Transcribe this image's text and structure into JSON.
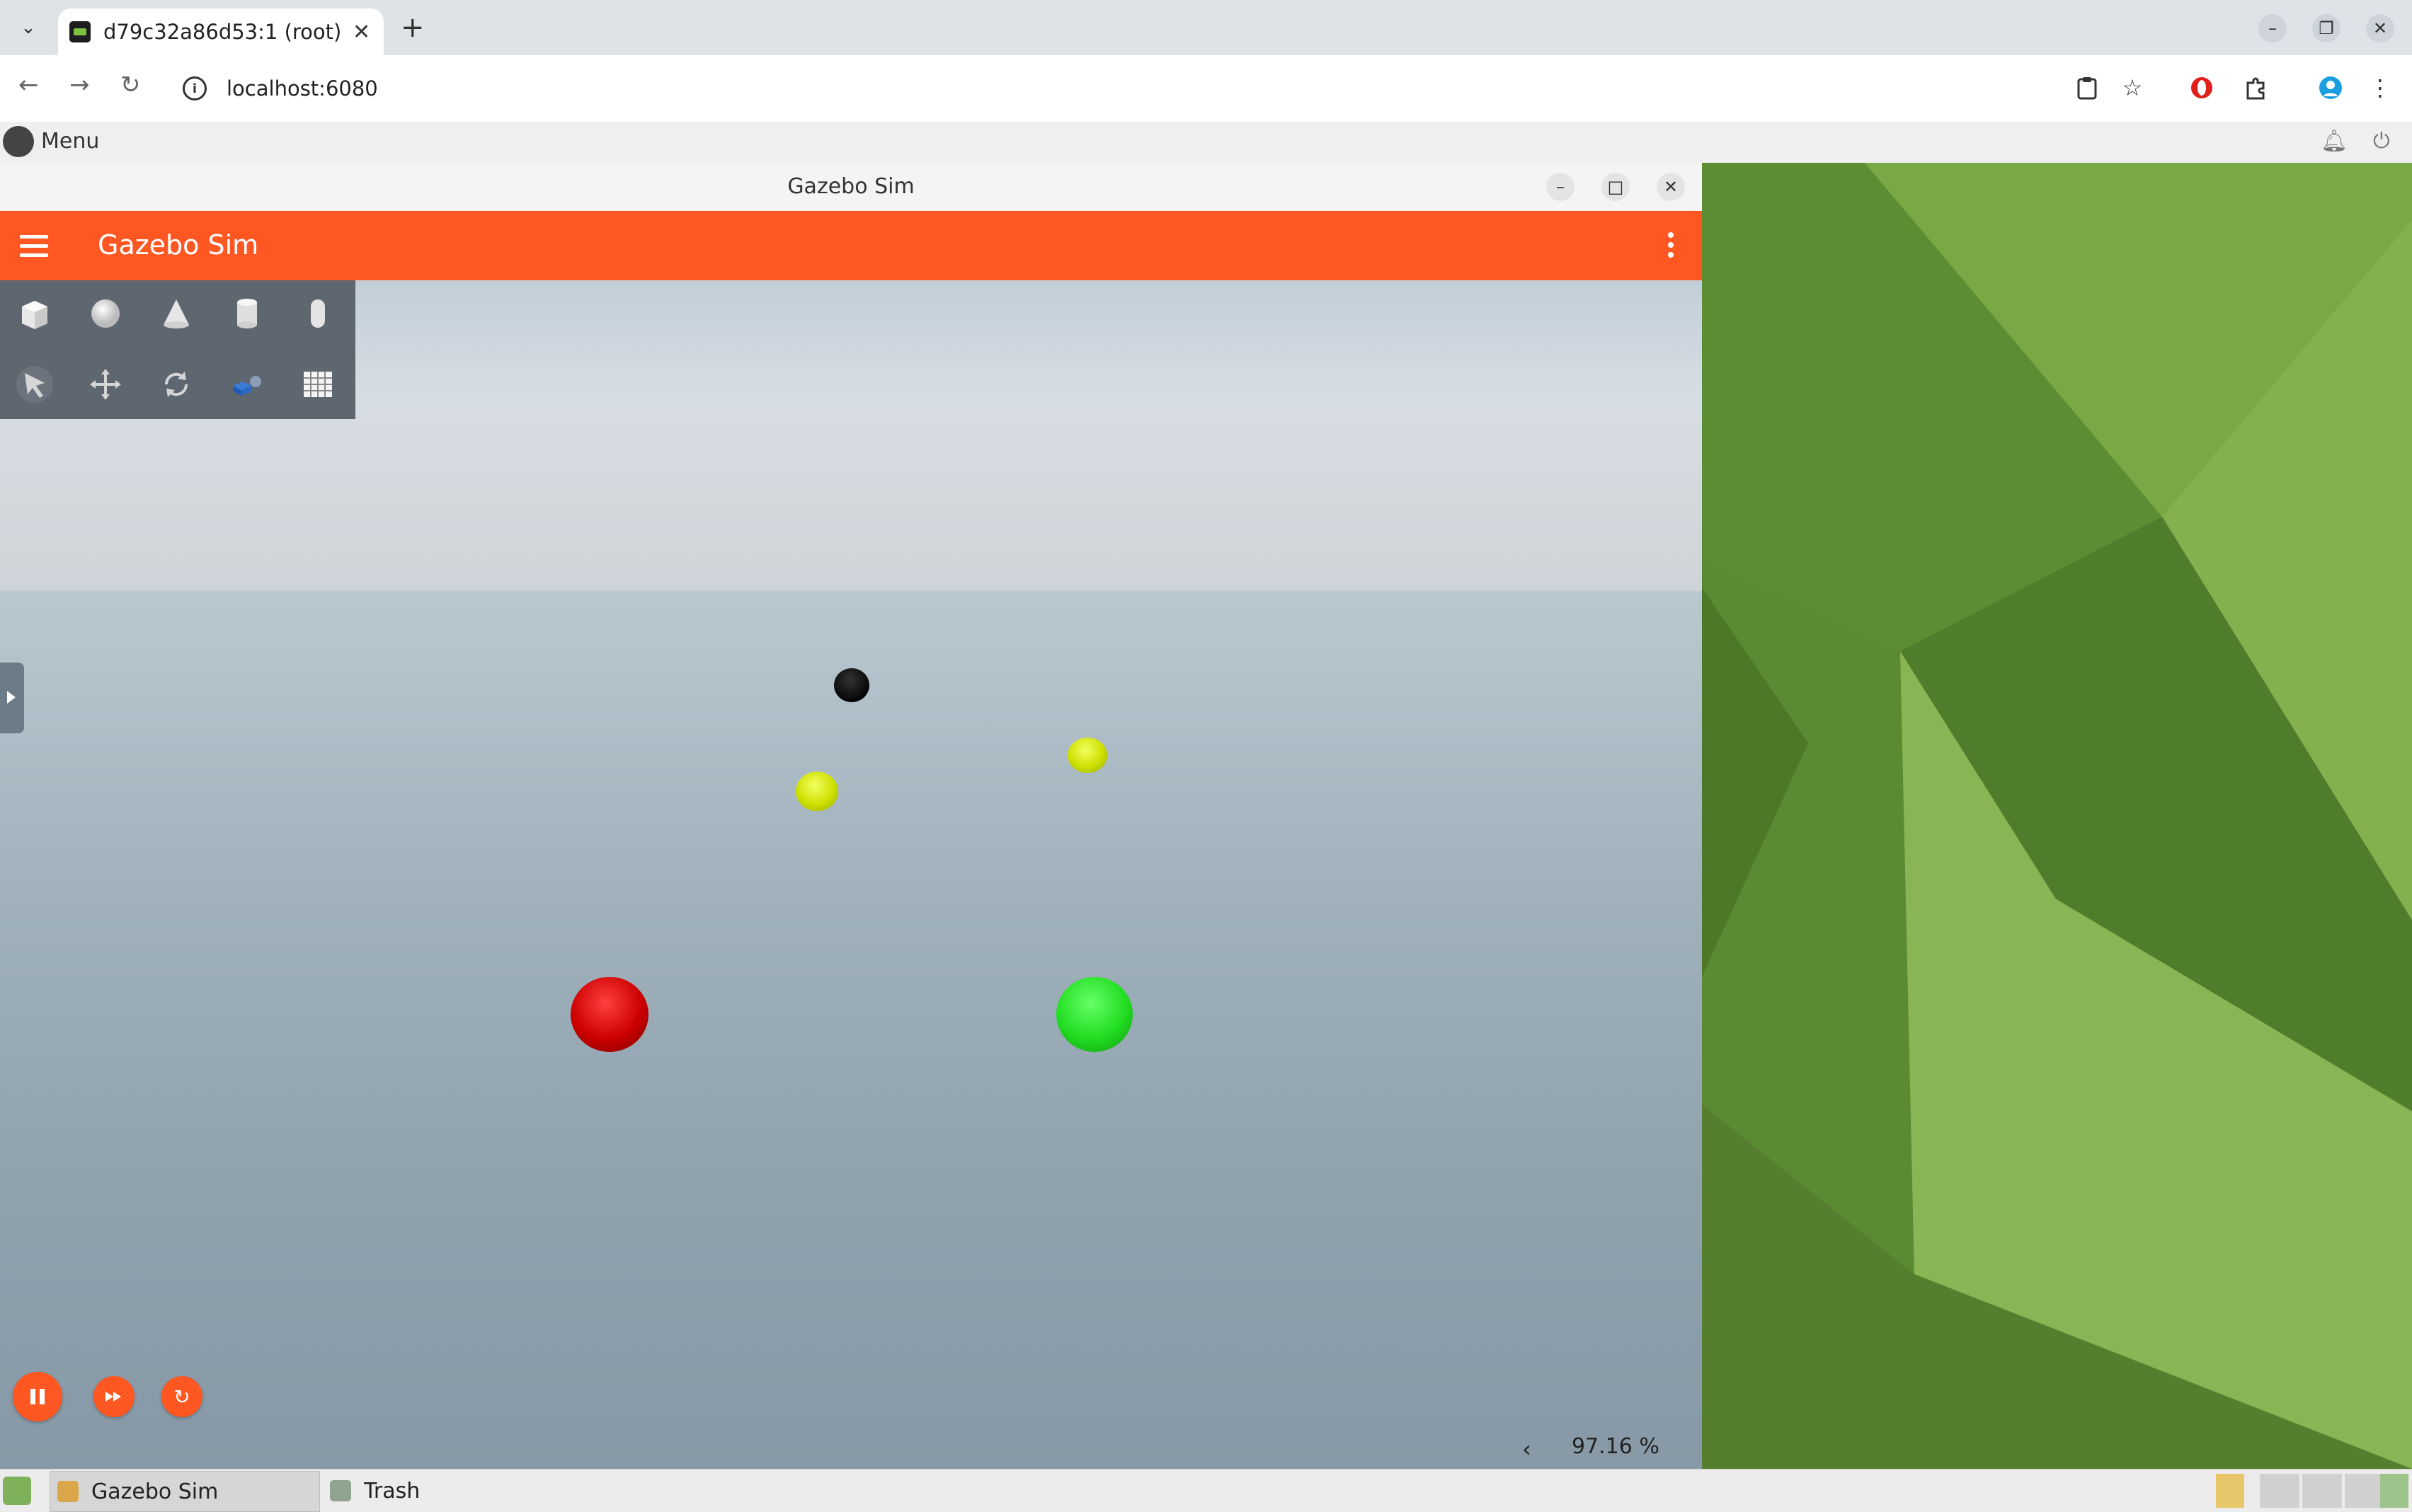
{
  "browser": {
    "tab_title": "d79c32a86d53:1 (root) -",
    "url": "localhost:6080"
  },
  "vnc": {
    "menu_label": "Menu"
  },
  "gazebo": {
    "window_title": "Gazebo Sim",
    "app_title": "Gazebo Sim",
    "real_time_factor": "97.16 %",
    "rtf_arrow": "‹",
    "toolbar_shapes": [
      "box-icon",
      "sphere-icon",
      "cone-icon",
      "cylinder-icon",
      "capsule-icon"
    ],
    "toolbar_tools": [
      "select-icon",
      "translate-icon",
      "rotate-icon",
      "spawn-icon",
      "grid-icon"
    ],
    "colors": {
      "accent": "#ff5722",
      "ball_black": "#0a0a0a",
      "ball_yellow": "#d6ef00",
      "ball_red": "#d40000",
      "ball_green": "#1ee01e"
    }
  },
  "taskbar": {
    "items": [
      {
        "label": "Gazebo Sim"
      },
      {
        "label": "Trash"
      }
    ]
  }
}
